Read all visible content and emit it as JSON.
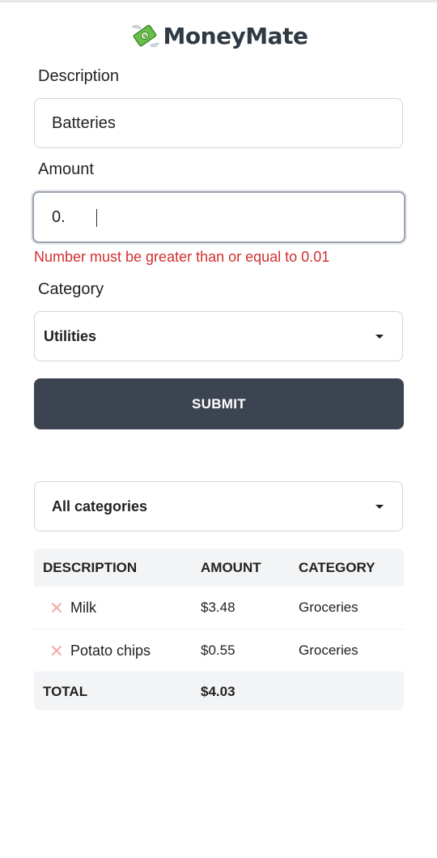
{
  "app": {
    "title": "MoneyMate"
  },
  "form": {
    "description_label": "Description",
    "description_value": "Batteries",
    "amount_label": "Amount",
    "amount_value": "0.",
    "amount_error": "Number must be greater than or equal to 0.01",
    "category_label": "Category",
    "category_value": "Utilities",
    "submit_label": "SUBMIT"
  },
  "filter": {
    "value": "All categories"
  },
  "table": {
    "headers": [
      "DESCRIPTION",
      "AMOUNT",
      "CATEGORY"
    ],
    "rows": [
      {
        "description": "Milk",
        "amount": "$3.48",
        "category": "Groceries"
      },
      {
        "description": "Potato chips",
        "amount": "$0.55",
        "category": "Groceries"
      }
    ],
    "total_label": "TOTAL",
    "total_value": "$4.03"
  },
  "colors": {
    "submit_bg": "#3d4451",
    "error": "#d32f2f",
    "delete_icon": "#f4a7a7"
  },
  "icons": {
    "brand": "money-with-wings-icon",
    "delete": "close-icon",
    "dropdown": "caret-down-icon"
  }
}
